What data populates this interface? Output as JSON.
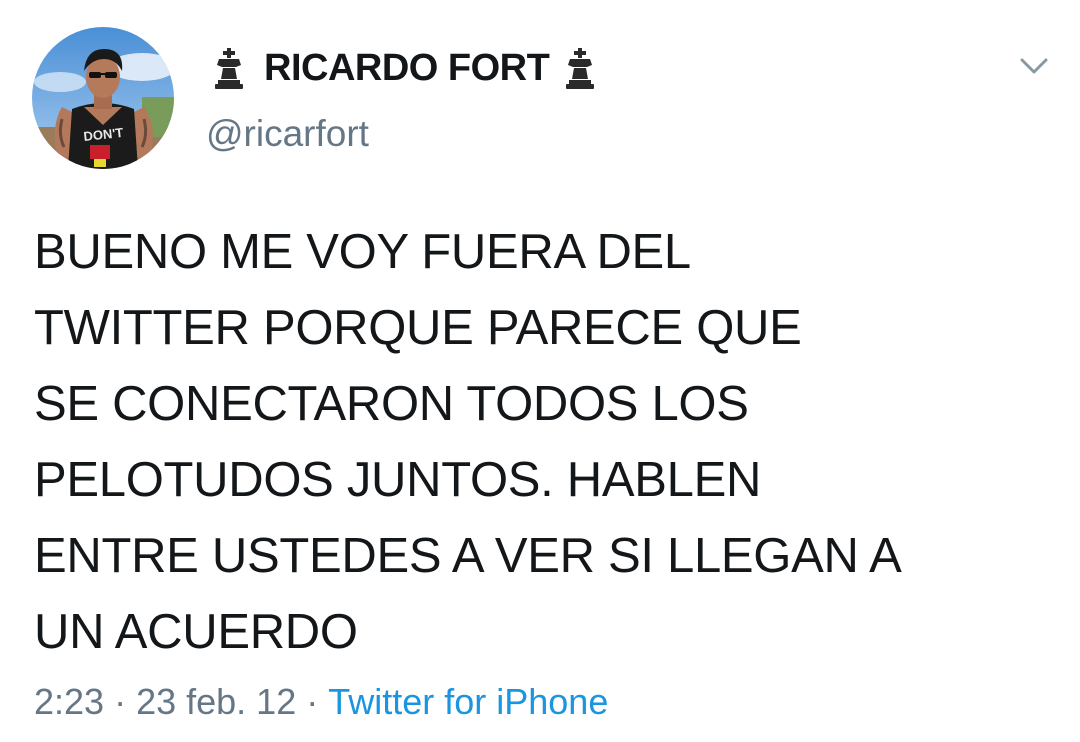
{
  "tweet": {
    "author": {
      "display_name": "RICARDO FORT",
      "handle": "@ricarfort",
      "name_decoration": "chess-king-icon",
      "avatar_shirt_text": "DON'T"
    },
    "text_lines": [
      "BUENO ME VOY FUERA DEL",
      "TWITTER PORQUE PARECE QUE",
      "SE CONECTARON TODOS LOS",
      "PELOTUDOS JUNTOS. HABLEN",
      "ENTRE USTEDES A VER SI LLEGAN A",
      "UN ACUERDO"
    ],
    "time": "2:23",
    "date": "23 feb. 12",
    "separator": "·",
    "source": "Twitter for iPhone"
  },
  "icons": {
    "menu": "chevron-down-icon"
  },
  "colors": {
    "text": "#14171a",
    "secondary": "#657786",
    "link": "#1b95e0"
  }
}
